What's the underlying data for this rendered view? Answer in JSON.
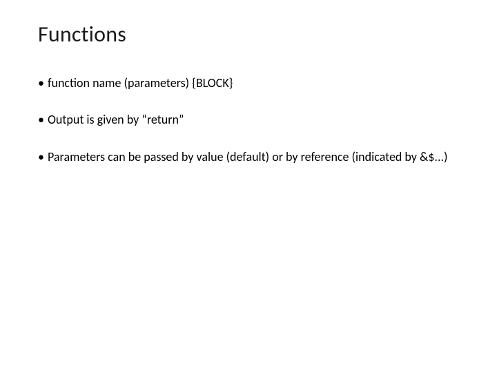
{
  "slide": {
    "title": "Functions",
    "bullets": [
      "function name (parameters) {BLOCK}",
      "Output is given by “return”",
      "Parameters can be passed by value (default) or by reference (indicated by &$...)"
    ]
  }
}
